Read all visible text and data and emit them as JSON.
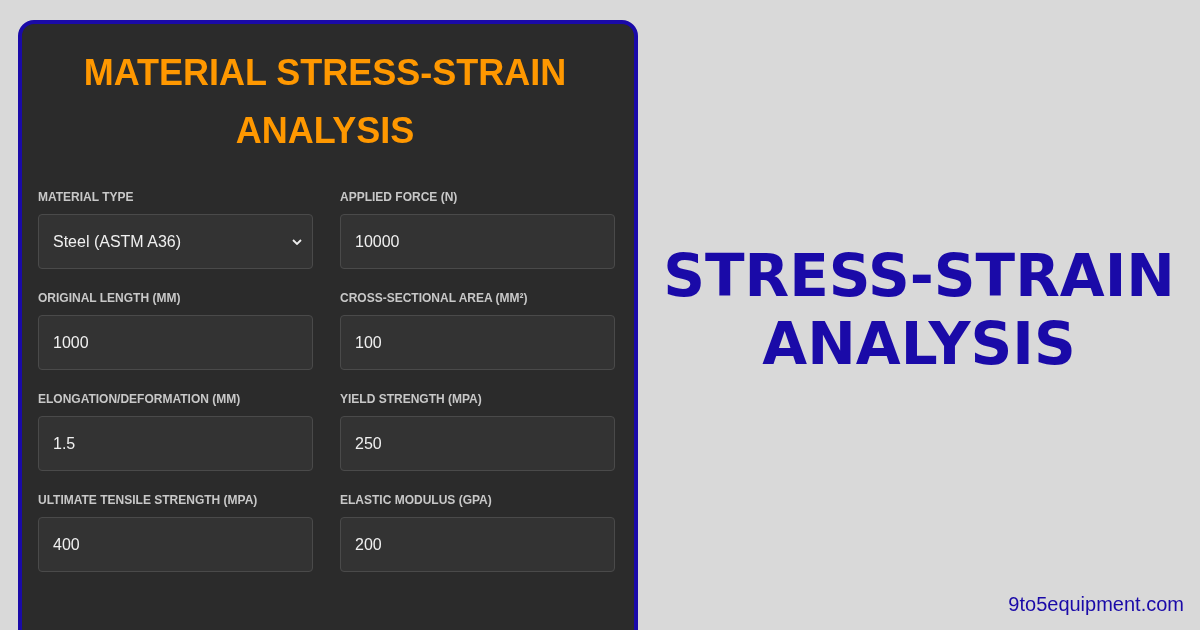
{
  "calculator": {
    "title": "MATERIAL STRESS-STRAIN ANALYSIS",
    "fields": [
      {
        "label": "MATERIAL TYPE",
        "kind": "select",
        "value": "Steel (ASTM A36)"
      },
      {
        "label": "APPLIED FORCE (N)",
        "kind": "input",
        "value": "10000"
      },
      {
        "label": "ORIGINAL LENGTH (MM)",
        "kind": "input",
        "value": "1000"
      },
      {
        "label": "CROSS-SECTIONAL AREA (MM²)",
        "kind": "input",
        "value": "100"
      },
      {
        "label": "ELONGATION/DEFORMATION (MM)",
        "kind": "input",
        "value": "1.5"
      },
      {
        "label": "YIELD STRENGTH (MPA)",
        "kind": "input",
        "value": "250"
      },
      {
        "label": "ULTIMATE TENSILE STRENGTH (MPA)",
        "kind": "input",
        "value": "400"
      },
      {
        "label": "ELASTIC MODULUS (GPA)",
        "kind": "input",
        "value": "200"
      }
    ]
  },
  "banner": {
    "heading": "STRESS-STRAIN ANALYSIS",
    "site": "9to5equipment.com"
  }
}
